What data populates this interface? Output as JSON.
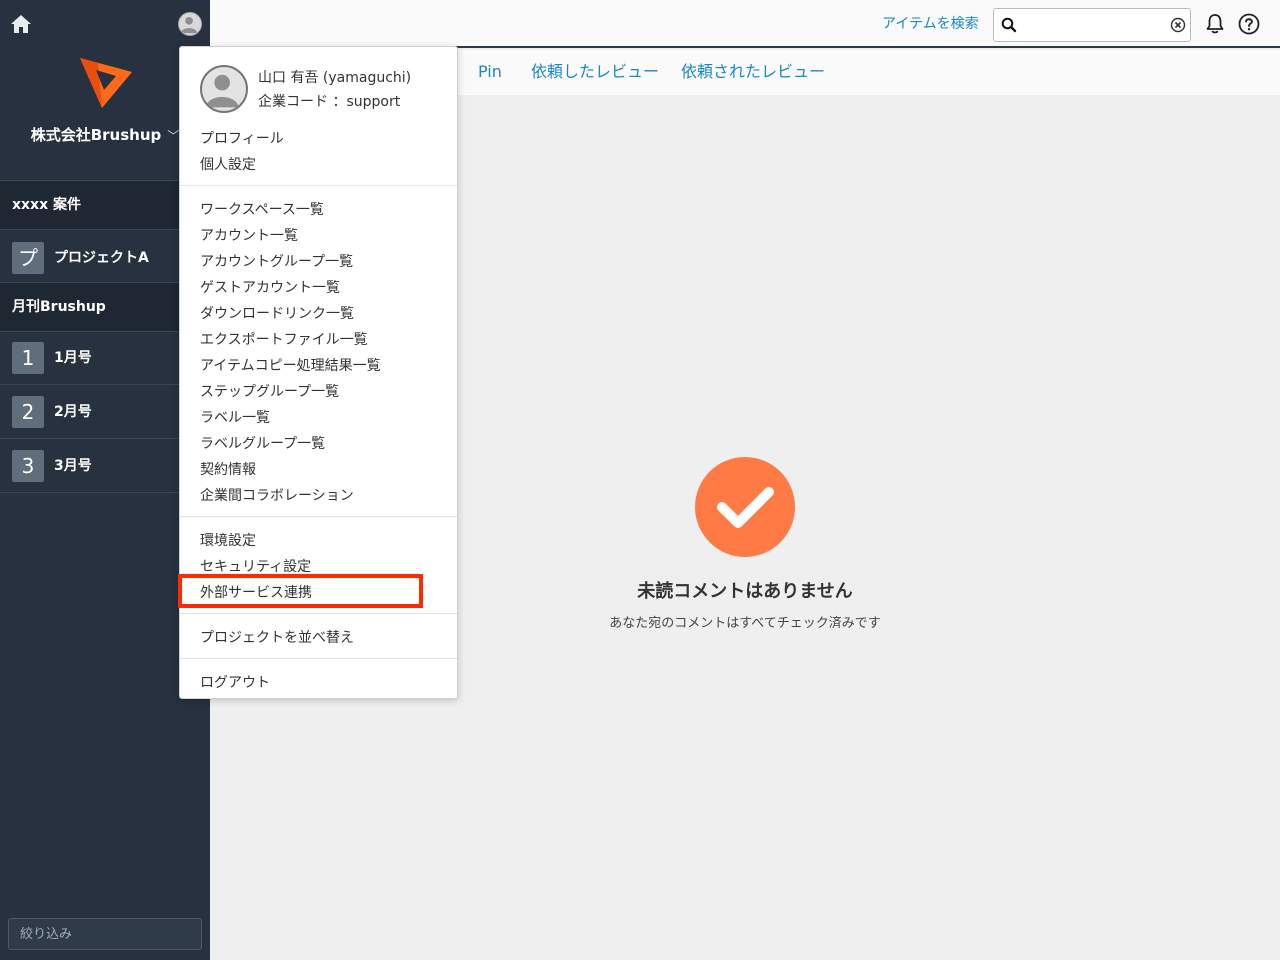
{
  "sidebar": {
    "company_name": "株式会社Brushup",
    "groups": [
      {
        "label": "xxxx 案件"
      },
      {
        "label": "月刊Brushup"
      }
    ],
    "projects": [
      {
        "badge": "プ",
        "label": "プロジェクトA"
      },
      {
        "badge": "1",
        "label": "1月号"
      },
      {
        "badge": "2",
        "label": "2月号"
      },
      {
        "badge": "3",
        "label": "3月号"
      }
    ],
    "filter_placeholder": "絞り込み"
  },
  "header": {
    "search_link": "アイテムを検索",
    "search_value": ""
  },
  "tabs": [
    {
      "label": "Pin"
    },
    {
      "label": "依頼したレビュー"
    },
    {
      "label": "依頼されたレビュー"
    }
  ],
  "empty_state": {
    "title": "未読コメントはありません",
    "subtitle": "あなた宛のコメントはすべてチェック済みです",
    "icon_color": "#ff7a45"
  },
  "menu": {
    "user_name": "山口 有吾 (yamaguchi)",
    "company_code": "企業コード ：support",
    "sections": [
      [
        "プロフィール",
        "個人設定"
      ],
      [
        "ワークスペース一覧",
        "アカウント一覧",
        "アカウントグループ一覧",
        "ゲストアカウント一覧",
        "ダウンロードリンク一覧",
        "エクスポートファイル一覧",
        "アイテムコピー処理結果一覧",
        "ステップグループ一覧",
        "ラベル一覧",
        "ラベルグループ一覧",
        "契約情報",
        "企業間コラボレーション"
      ],
      [
        "環境設定",
        "セキュリティ設定",
        "外部サービス連携"
      ],
      [
        "プロジェクトを並べ替え"
      ],
      [
        "ログアウト"
      ]
    ]
  },
  "colors": {
    "sidebar_bg": "#27313f",
    "link": "#1b87c5",
    "highlight": "#ff2a00",
    "brand_orange": "#ff6a1a"
  }
}
